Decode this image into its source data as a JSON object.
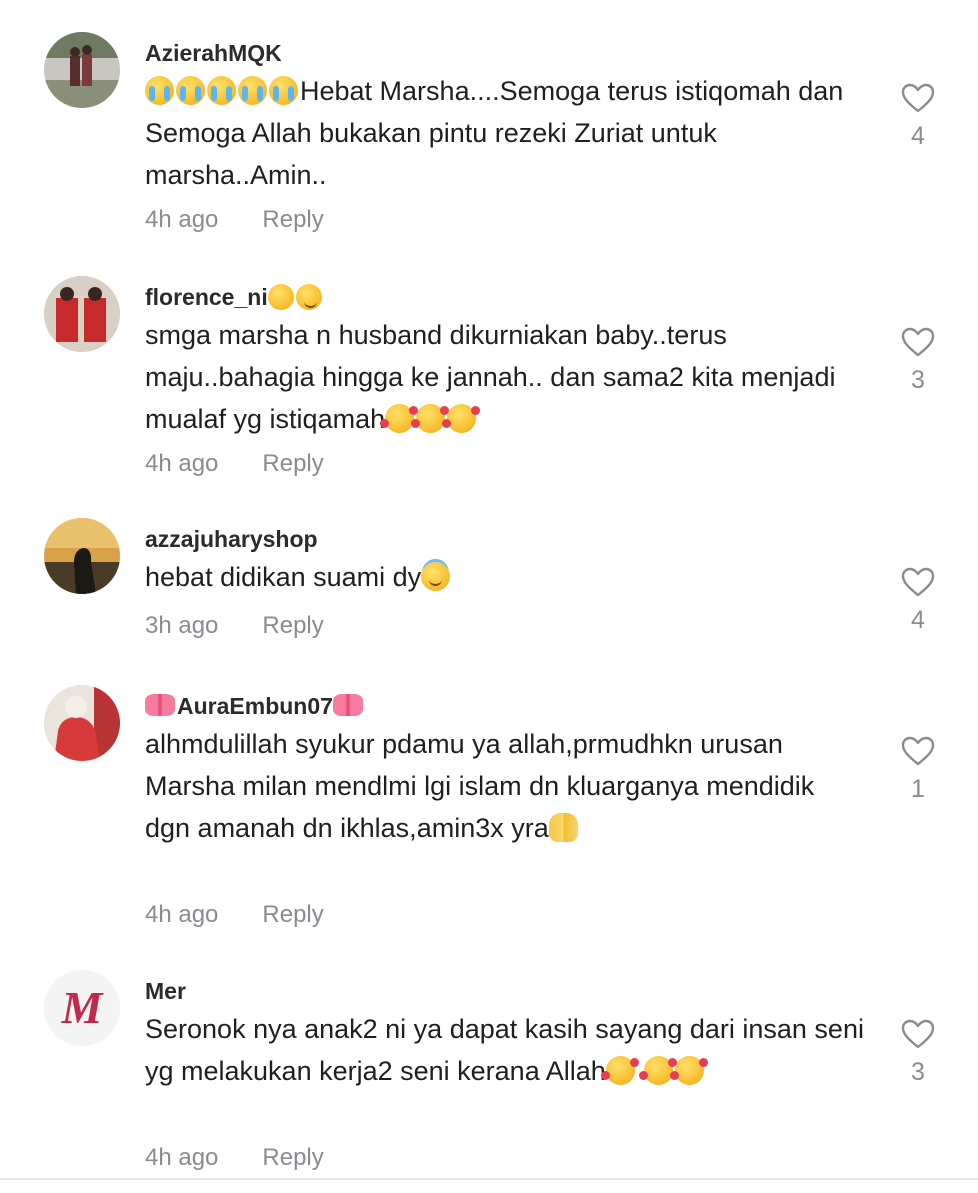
{
  "comments": [
    {
      "username": "AzierahMQK",
      "text": "Hebat Marsha....Semoga terus istiqomah dan Semoga Allah bukakan pintu rezeki Zuriat untuk marsha..Amin..",
      "time": "4h ago",
      "reply_label": "Reply",
      "likes": "4"
    },
    {
      "username": "florence_ni",
      "text": "smga marsha n husband dikurniakan baby..terus maju..bahagia hingga ke jannah.. dan sama2 kita menjadi mualaf yg istiqamah",
      "time": "4h ago",
      "reply_label": "Reply",
      "likes": "3"
    },
    {
      "username": "azzajuharyshop",
      "text": "hebat didikan suami dy",
      "time": "3h ago",
      "reply_label": "Reply",
      "likes": "4"
    },
    {
      "username": "AuraEmbun07",
      "text": "alhmdulillah syukur pdamu ya allah,prmudhkn urusan Marsha milan mendlmi lgi islam dn kluarganya mendidik dgn amanah dn ikhlas,amin3x yra",
      "time": "4h ago",
      "reply_label": "Reply",
      "likes": "1"
    },
    {
      "username": "Mer",
      "text": "Seronok nya anak2 ni ya dapat kasih sayang dari insan seni yg melakukan kerja2 seni kerana Allah",
      "time": "4h ago",
      "reply_label": "Reply",
      "likes": "3",
      "avatar_letter": "M"
    }
  ],
  "icons": {
    "like": "heart-outline-icon",
    "emoji": [
      "loudly-crying-face",
      "smiling-face-with-hearts",
      "smiling-face-with-halo",
      "palms-up-together",
      "pink-bow",
      "relieved-face"
    ]
  },
  "colors": {
    "text": "#1f1f1f",
    "muted": "#8a8b91",
    "username": "#2b2b2b",
    "avatar_letter": "#c22a4d"
  }
}
